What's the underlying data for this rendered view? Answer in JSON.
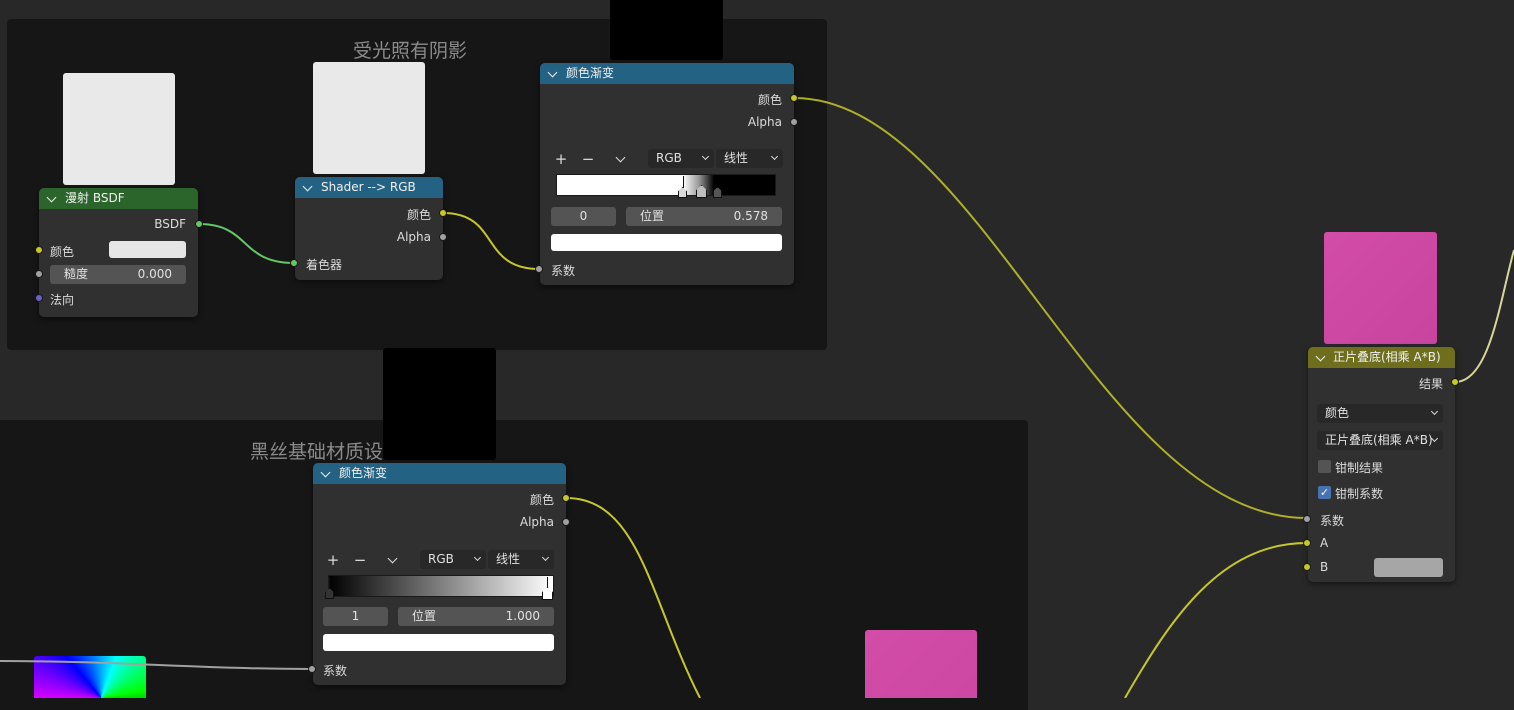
{
  "frames": {
    "top_title": "受光照有阴影",
    "bottom_title": "黑丝基础材质设"
  },
  "nodes": {
    "diffuse": {
      "title": "漫射 BSDF",
      "output": "BSDF",
      "inputs": {
        "color": "颜色",
        "roughness_label": "糙度",
        "roughness_value": "0.000",
        "normal": "法向"
      }
    },
    "shader_to_rgb": {
      "title": "Shader --> RGB",
      "out_color": "颜色",
      "out_alpha": "Alpha",
      "in_shader": "着色器"
    },
    "ramp_top": {
      "title": "颜色渐变",
      "out_color": "颜色",
      "out_alpha": "Alpha",
      "mode": "RGB",
      "interp": "线性",
      "stop_index": "0",
      "pos_label": "位置",
      "pos_value": "0.578",
      "in_fac": "系数"
    },
    "ramp_bottom": {
      "title": "颜色渐变",
      "out_color": "颜色",
      "out_alpha": "Alpha",
      "mode": "RGB",
      "interp": "线性",
      "stop_index": "1",
      "pos_label": "位置",
      "pos_value": "1.000",
      "in_fac": "系数"
    },
    "multiply": {
      "title": "正片叠底(相乘 A*B)",
      "out_result": "结果",
      "data_type": "颜色",
      "blend_mode": "正片叠底(相乘 A*B)",
      "clamp_result": "钳制结果",
      "clamp_result_checked": false,
      "clamp_factor": "钳制系数",
      "clamp_factor_checked": true,
      "in_fac": "系数",
      "in_a": "A",
      "in_b": "B"
    }
  },
  "toolbar": {
    "add": "+",
    "remove": "−"
  },
  "colors": {
    "bg": "#282828",
    "frame": "#161616",
    "node": "#303030",
    "header_shader": "#2b652b",
    "header_converter": "#246283",
    "header_color": "#6e6e1d",
    "socket_color": "#c7c729",
    "socket_float": "#a1a1a1",
    "socket_shader": "#63c763",
    "socket_vector": "#6363c7",
    "accent_check": "#4772b3",
    "preview_pink": "#d04aa6"
  }
}
